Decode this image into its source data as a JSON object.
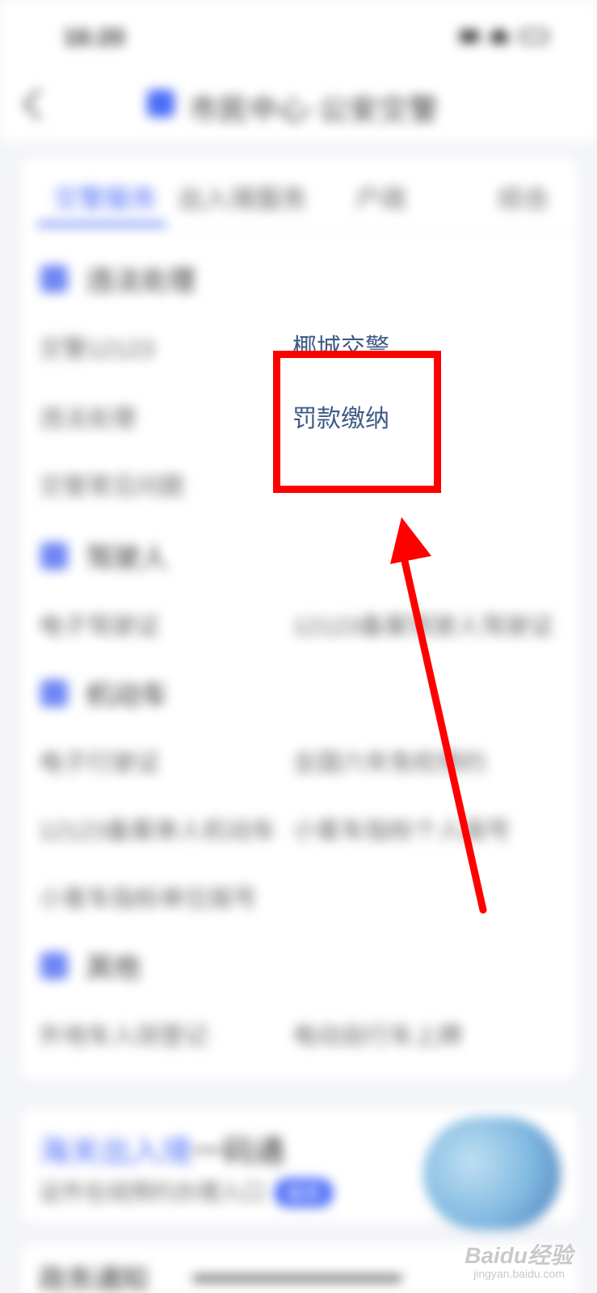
{
  "status_bar": {
    "time": "16:20"
  },
  "header": {
    "title": "市民中心·公安交警"
  },
  "tabs": [
    {
      "label": "交警服务"
    },
    {
      "label": "出入境服务"
    },
    {
      "label": "户政"
    },
    {
      "label": "综合"
    }
  ],
  "sections": {
    "law": {
      "title": "违法处理",
      "items": [
        "交警12123",
        "椰城交警",
        "违法处理",
        "罚款缴纳",
        "交管常见问题"
      ]
    },
    "driver": {
      "title": "驾驶人",
      "items": [
        "电子驾驶证",
        "12123备案驾驶人驾驶证"
      ]
    },
    "vehicle": {
      "title": "机动车",
      "items": [
        "电子行驶证",
        "全国六年免检预约",
        "12123备案单人机动车",
        "小客车指标个人摇号",
        "小客车指标单位摇号"
      ]
    },
    "other": {
      "title": "其他",
      "items": [
        "外地车入琼登记",
        "电动自行车上牌"
      ]
    }
  },
  "promo": {
    "title_accent": "海关出入境",
    "title_rest": "一码通",
    "subtitle": "证件在线预约办理入口",
    "badge": "推荐"
  },
  "second_card": {
    "title": "政务通知"
  },
  "watermark": {
    "brand": "Baidu经验",
    "url": "jingyan.baidu.com"
  },
  "colors": {
    "accent": "#4a6cf7",
    "highlight": "#ff0000",
    "focus_text": "#3d5a85"
  }
}
